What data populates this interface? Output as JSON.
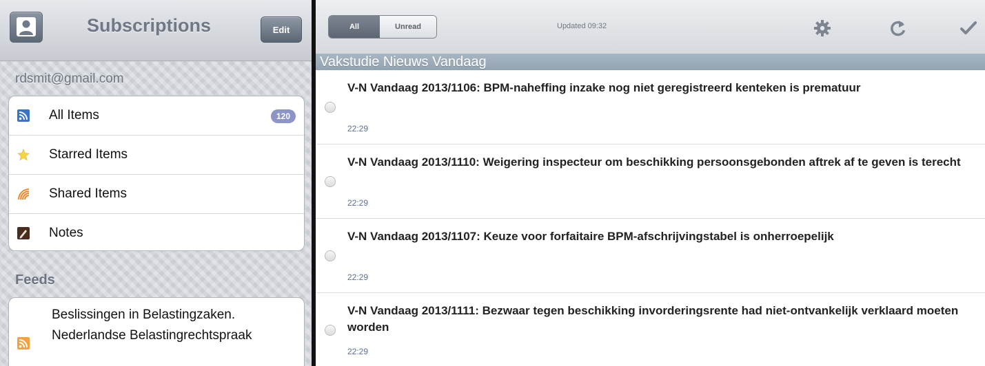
{
  "sidebar": {
    "title": "Subscriptions",
    "edit_label": "Edit",
    "account": "rdsmit@gmail.com",
    "items": [
      {
        "label": "All Items",
        "icon": "rss-icon",
        "badge": "120"
      },
      {
        "label": "Starred Items",
        "icon": "star-icon"
      },
      {
        "label": "Shared Items",
        "icon": "shared-icon"
      },
      {
        "label": "Notes",
        "icon": "notes-icon"
      }
    ],
    "feeds_header": "Feeds",
    "feeds": [
      {
        "label": "Beslissingen in Belastingzaken. Nederlandse Belastingrechtspraak",
        "icon": "rss-icon"
      }
    ]
  },
  "toolbar": {
    "filter_all": "All",
    "filter_unread": "Unread",
    "updated": "Updated 09:32"
  },
  "section": {
    "title": "Vakstudie Nieuws Vandaag"
  },
  "articles": [
    {
      "title": "V-N Vandaag 2013/1106: BPM-naheffing inzake nog niet geregistreerd kenteken is prematuur",
      "time": "22:29"
    },
    {
      "title": "V-N Vandaag 2013/1110: Weigering inspecteur om beschikking persoonsgebonden aftrek af te geven is terecht",
      "time": "22:29"
    },
    {
      "title": "V-N Vandaag 2013/1107: Keuze voor forfaitaire BPM-afschrijvingstabel is onherroepelijk",
      "time": "22:29"
    },
    {
      "title": "V-N Vandaag 2013/1111: Bezwaar tegen beschikking invorderingsrente had niet-ontvankelijk verklaard moeten worden",
      "time": "22:29"
    }
  ],
  "colors": {
    "badge": "#8c94c8",
    "section_header": "#9fafbd",
    "time_text": "#5a6f8e"
  }
}
